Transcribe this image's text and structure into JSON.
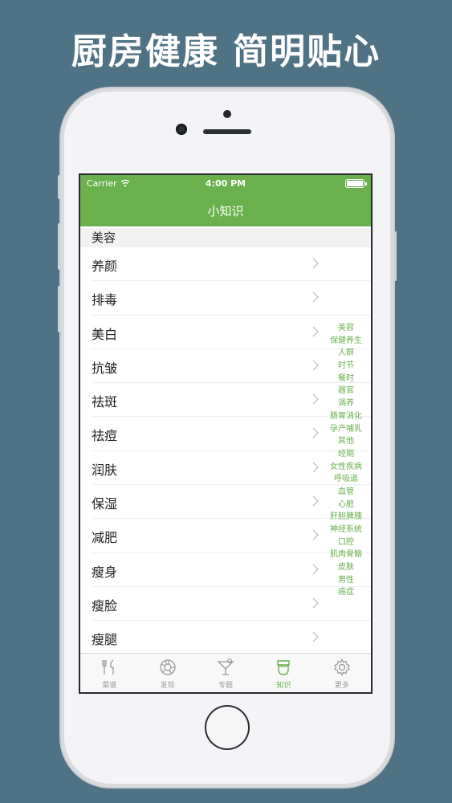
{
  "promo": {
    "title": "厨房健康 简明贴心"
  },
  "status_bar": {
    "carrier": "Carrier",
    "time": "4:00 PM"
  },
  "nav": {
    "title": "小知识"
  },
  "section": {
    "title": "美容"
  },
  "list": {
    "items": [
      {
        "label": "养颜"
      },
      {
        "label": "排毒"
      },
      {
        "label": "美白"
      },
      {
        "label": "抗皱"
      },
      {
        "label": "祛斑"
      },
      {
        "label": "祛痘"
      },
      {
        "label": "润肤"
      },
      {
        "label": "保湿"
      },
      {
        "label": "减肥"
      },
      {
        "label": "瘦身"
      },
      {
        "label": "瘦脸"
      },
      {
        "label": "瘦腿"
      }
    ]
  },
  "index": {
    "items": [
      "美容",
      "保健养生",
      "人群",
      "时节",
      "餐时",
      "器官",
      "调养",
      "肠胃消化",
      "孕产哺乳",
      "其他",
      "经期",
      "女性疾病",
      "呼吸道",
      "血管",
      "心脏",
      "肝胆脾胰",
      "神经系统",
      "口腔",
      "肌肉骨骼",
      "皮肤",
      "男性",
      "癌症"
    ]
  },
  "tabbar": {
    "tabs": [
      {
        "label": "菜谱",
        "icon": "fork-knife-icon"
      },
      {
        "label": "发现",
        "icon": "aperture-icon"
      },
      {
        "label": "专题",
        "icon": "cocktail-icon"
      },
      {
        "label": "知识",
        "icon": "chef-icon"
      },
      {
        "label": "更多",
        "icon": "gear-icon"
      }
    ],
    "active_index": 3
  },
  "colors": {
    "accent": "#6ab04c",
    "background": "#4f7384",
    "tab_inactive": "#9a9a9a"
  }
}
